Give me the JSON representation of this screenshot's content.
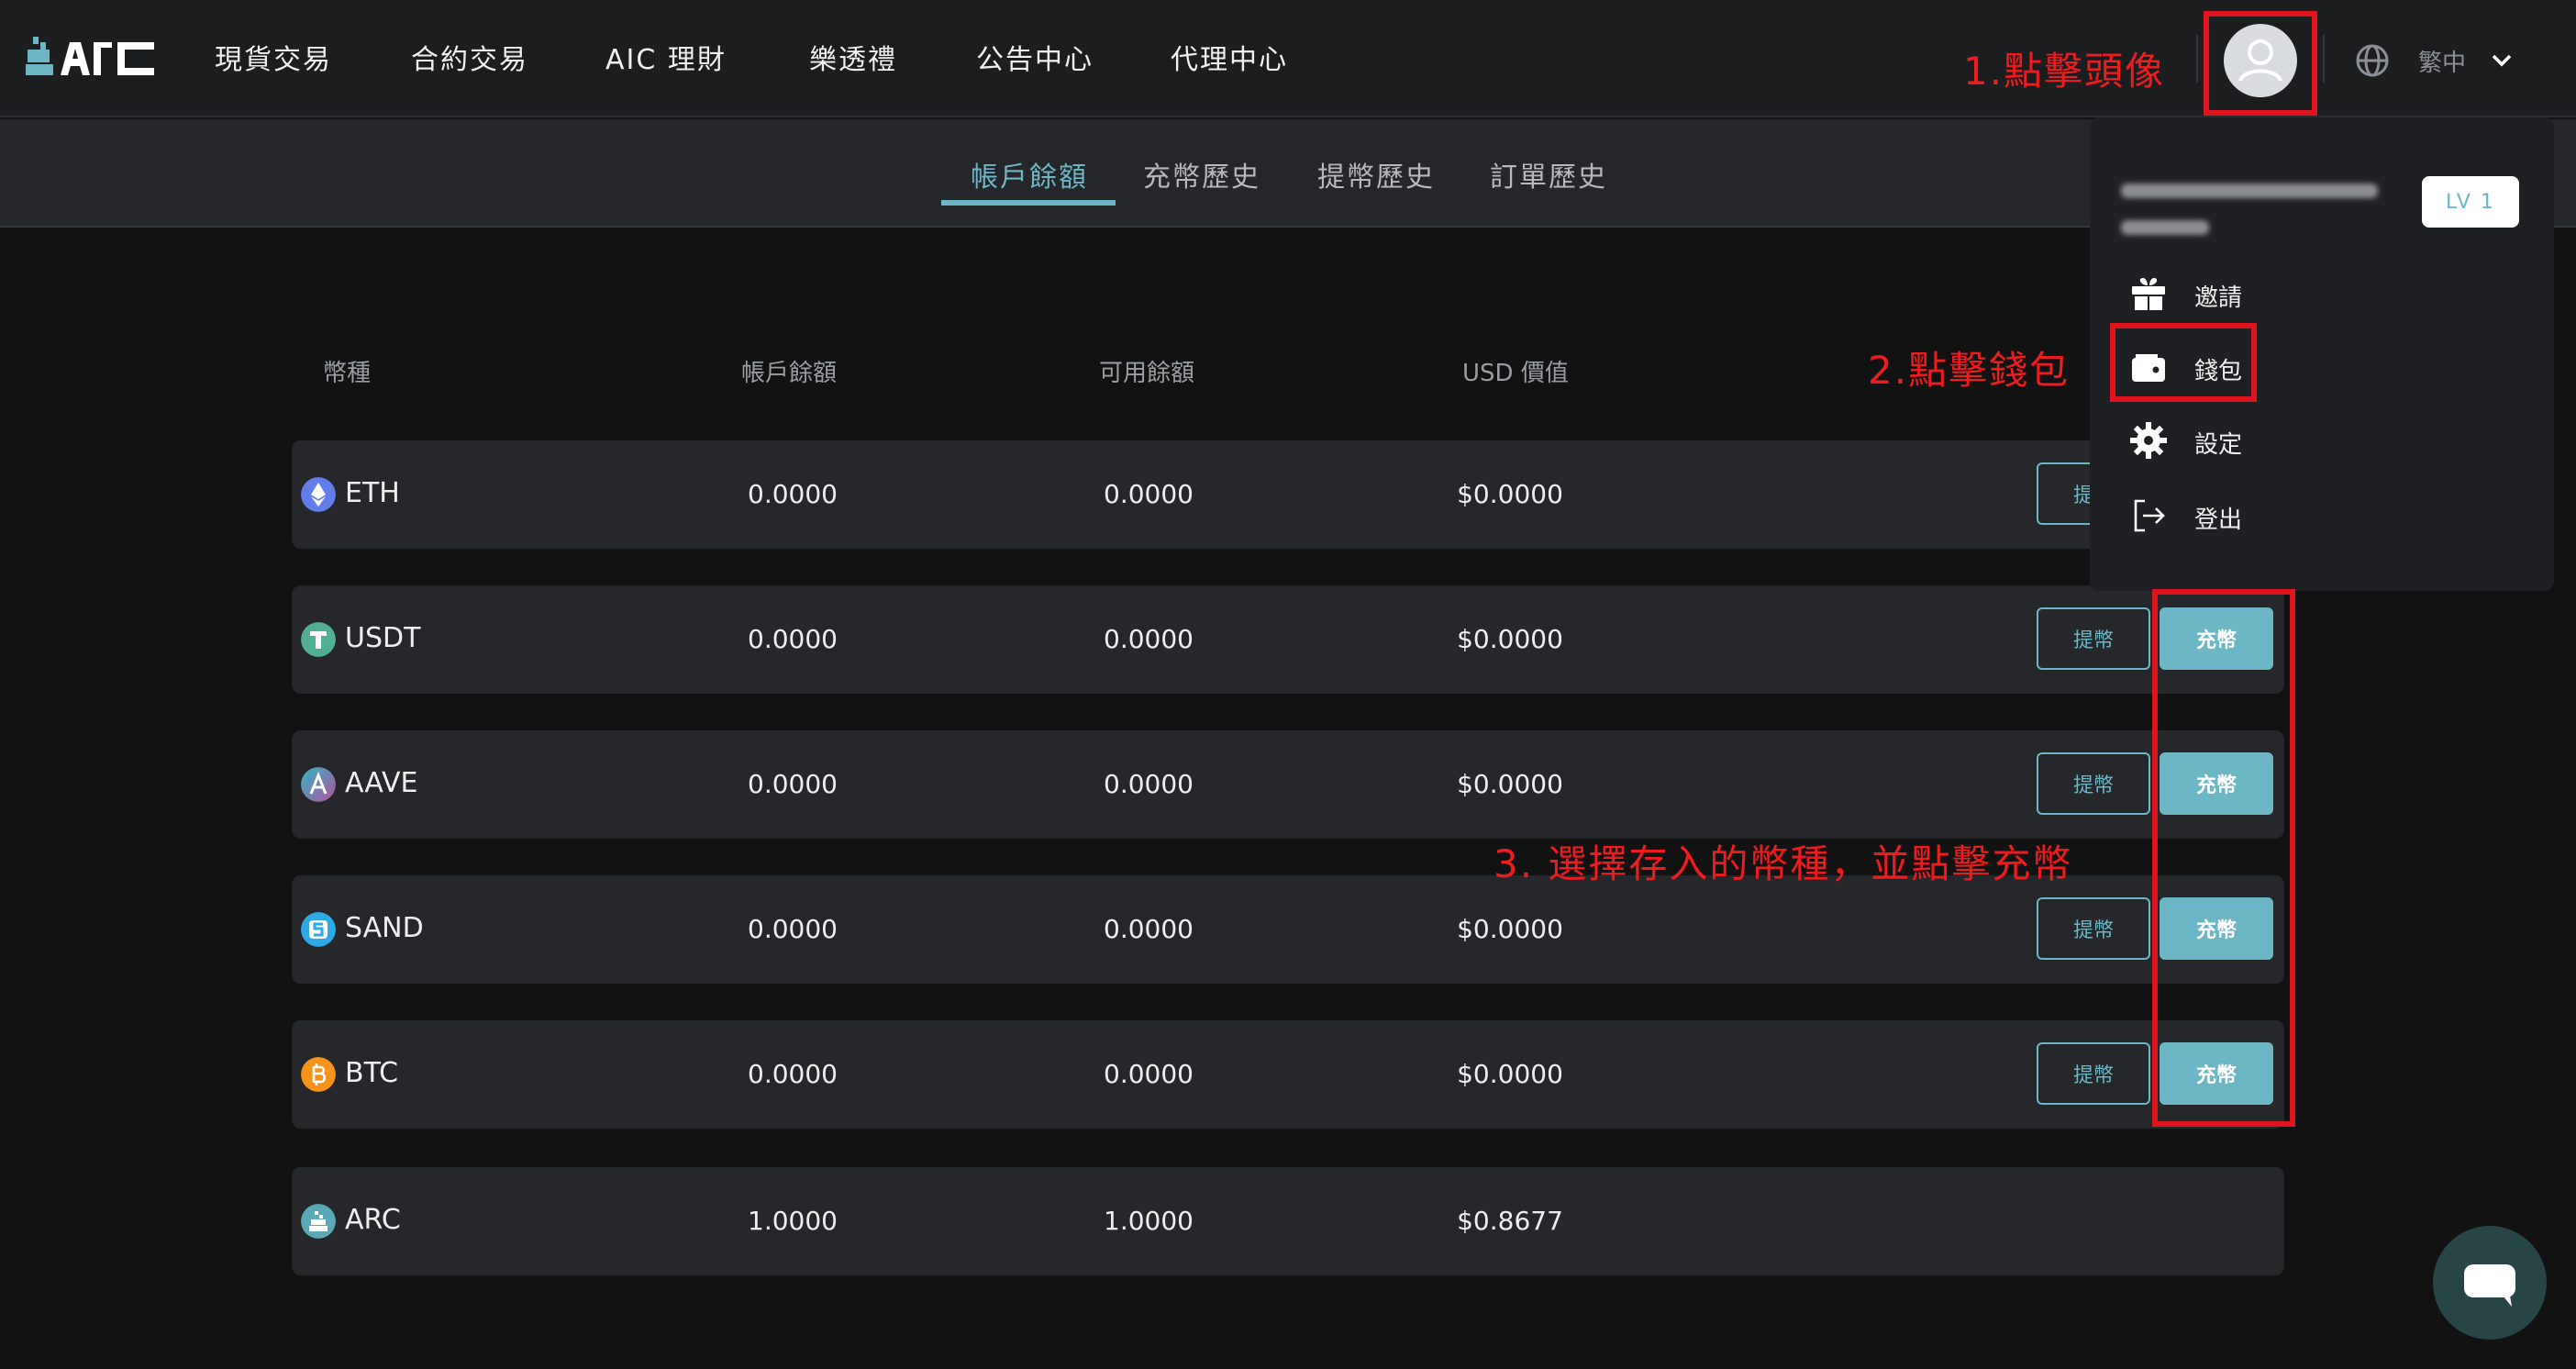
{
  "header": {
    "logo_text": "AIC",
    "nav": [
      "現貨交易",
      "合約交易",
      "AIC 理財",
      "樂透禮",
      "公告中心",
      "代理中心"
    ],
    "language": "繁中"
  },
  "subnav": {
    "tabs": [
      "帳戶餘額",
      "充幣歷史",
      "提幣歷史",
      "訂單歷史"
    ],
    "active": "帳戶餘額"
  },
  "table": {
    "columns": [
      "幣種",
      "帳戶餘額",
      "可用餘額",
      "USD 價值"
    ],
    "withdraw_label": "提幣",
    "deposit_label": "充幣",
    "rows": [
      {
        "coin": "ETH",
        "balance": "0.0000",
        "available": "0.0000",
        "usd": "$0.0000",
        "icon": "eth-icon",
        "color": "#627eea"
      },
      {
        "coin": "USDT",
        "balance": "0.0000",
        "available": "0.0000",
        "usd": "$0.0000",
        "icon": "usdt-icon",
        "color": "#50af95"
      },
      {
        "coin": "AAVE",
        "balance": "0.0000",
        "available": "0.0000",
        "usd": "$0.0000",
        "icon": "aave-icon",
        "color": "#8a5aa8"
      },
      {
        "coin": "SAND",
        "balance": "0.0000",
        "available": "0.0000",
        "usd": "$0.0000",
        "icon": "sand-icon",
        "color": "#2fa9e6"
      },
      {
        "coin": "BTC",
        "balance": "0.0000",
        "available": "0.0000",
        "usd": "$0.0000",
        "icon": "btc-icon",
        "color": "#f7931a"
      },
      {
        "coin": "ARC",
        "balance": "1.0000",
        "available": "1.0000",
        "usd": "$0.8677",
        "icon": "arc-icon",
        "color": "#5aa9b8"
      }
    ]
  },
  "user_menu": {
    "level": "LV 1",
    "items": [
      {
        "label": "邀請",
        "icon": "gift-icon"
      },
      {
        "label": "錢包",
        "icon": "wallet-icon"
      },
      {
        "label": "設定",
        "icon": "gear-icon"
      },
      {
        "label": "登出",
        "icon": "logout-icon"
      }
    ]
  },
  "annotations": {
    "step1": "1.點擊頭像",
    "step2": "2.點擊錢包",
    "step3": "3.  選擇存入的幣種，並點擊充幣"
  },
  "colors": {
    "accent": "#6cb6c6",
    "annotation": "#ee1c1c",
    "background": "#121213",
    "row_bg": "#25272a"
  }
}
